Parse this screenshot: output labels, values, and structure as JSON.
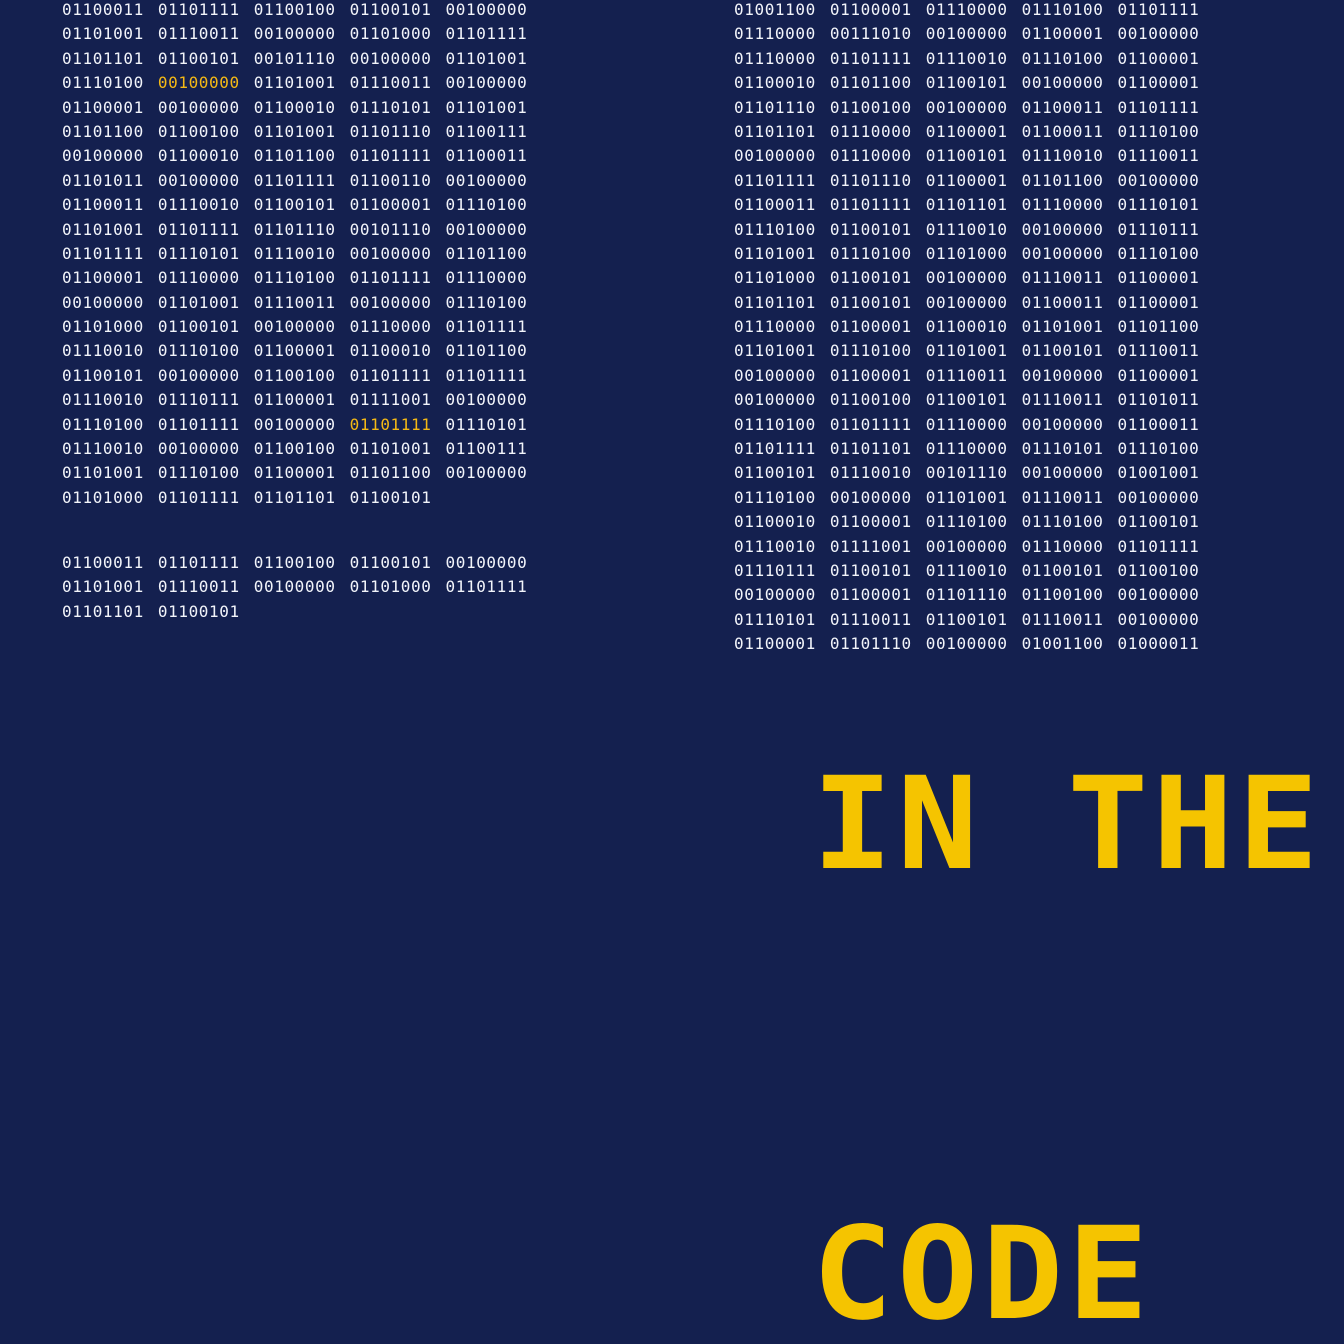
{
  "left_block_1": [
    [
      "01100011",
      "01101111",
      "01100100",
      "01100101",
      "00100000"
    ],
    [
      "01101001",
      "01110011",
      "00100000",
      "01101000",
      "01101111"
    ],
    [
      "01101101",
      "01100101",
      "00101110",
      "00100000",
      "01101001"
    ],
    [
      "01110100",
      "00100000",
      "01101001",
      "01110011",
      "00100000"
    ],
    [
      "01100001",
      "00100000",
      "01100010",
      "01110101",
      "01101001"
    ],
    [
      "01101100",
      "01100100",
      "01101001",
      "01101110",
      "01100111"
    ],
    [
      "00100000",
      "01100010",
      "01101100",
      "01101111",
      "01100011"
    ],
    [
      "01101011",
      "00100000",
      "01101111",
      "01100110",
      "00100000"
    ],
    [
      "01100011",
      "01110010",
      "01100101",
      "01100001",
      "01110100"
    ],
    [
      "01101001",
      "01101111",
      "01101110",
      "00101110",
      "00100000"
    ],
    [
      "01101111",
      "01110101",
      "01110010",
      "00100000",
      "01101100"
    ],
    [
      "01100001",
      "01110000",
      "01110100",
      "01101111",
      "01110000"
    ],
    [
      "00100000",
      "01101001",
      "01110011",
      "00100000",
      "01110100"
    ],
    [
      "01101000",
      "01100101",
      "00100000",
      "01110000",
      "01101111"
    ],
    [
      "01110010",
      "01110100",
      "01100001",
      "01100010",
      "01101100"
    ],
    [
      "01100101",
      "00100000",
      "01100100",
      "01101111",
      "01101111"
    ],
    [
      "01110010",
      "01110111",
      "01100001",
      "01111001",
      "00100000"
    ],
    [
      "01110100",
      "01101111",
      "00100000",
      "01101111",
      "01110101"
    ],
    [
      "01110010",
      "00100000",
      "01100100",
      "01101001",
      "01100111"
    ],
    [
      "01101001",
      "01110100",
      "01100001",
      "01101100",
      "00100000"
    ],
    [
      "01101000",
      "01101111",
      "01101101",
      "01100101"
    ]
  ],
  "left_highlights": [
    "3.1",
    "17.3"
  ],
  "left_block_2": [
    [
      "01100011",
      "01101111",
      "01100100",
      "01100101",
      "00100000"
    ],
    [
      "01101001",
      "01110011",
      "00100000",
      "01101000",
      "01101111"
    ],
    [
      "01101101",
      "01100101"
    ]
  ],
  "right_block": [
    [
      "01001100",
      "01100001",
      "01110000",
      "01110100",
      "01101111"
    ],
    [
      "01110000",
      "00111010",
      "00100000",
      "01100001",
      "00100000"
    ],
    [
      "01110000",
      "01101111",
      "01110010",
      "01110100",
      "01100001"
    ],
    [
      "01100010",
      "01101100",
      "01100101",
      "00100000",
      "01100001"
    ],
    [
      "01101110",
      "01100100",
      "00100000",
      "01100011",
      "01101111"
    ],
    [
      "01101101",
      "01110000",
      "01100001",
      "01100011",
      "01110100"
    ],
    [
      "00100000",
      "01110000",
      "01100101",
      "01110010",
      "01110011"
    ],
    [
      "01101111",
      "01101110",
      "01100001",
      "01101100",
      "00100000"
    ],
    [
      "01100011",
      "01101111",
      "01101101",
      "01110000",
      "01110101"
    ],
    [
      "01110100",
      "01100101",
      "01110010",
      "00100000",
      "01110111"
    ],
    [
      "01101001",
      "01110100",
      "01101000",
      "00100000",
      "01110100"
    ],
    [
      "01101000",
      "01100101",
      "00100000",
      "01110011",
      "01100001"
    ],
    [
      "01101101",
      "01100101",
      "00100000",
      "01100011",
      "01100001"
    ],
    [
      "01110000",
      "01100001",
      "01100010",
      "01101001",
      "01101100"
    ],
    [
      "01101001",
      "01110100",
      "01101001",
      "01100101",
      "01110011"
    ],
    [
      "00100000",
      "01100001",
      "01110011",
      "00100000",
      "01100001"
    ],
    [
      "00100000",
      "01100100",
      "01100101",
      "01110011",
      "01101011"
    ],
    [
      "01110100",
      "01101111",
      "01110000",
      "00100000",
      "01100011"
    ],
    [
      "01101111",
      "01101101",
      "01110000",
      "01110101",
      "01110100"
    ],
    [
      "01100101",
      "01110010",
      "00101110",
      "00100000",
      "01001001"
    ],
    [
      "01110100",
      "00100000",
      "01101001",
      "01110011",
      "00100000"
    ],
    [
      "01100010",
      "01100001",
      "01110100",
      "01110100",
      "01100101"
    ],
    [
      "01110010",
      "01111001",
      "00100000",
      "01110000",
      "01101111"
    ],
    [
      "01110111",
      "01100101",
      "01110010",
      "01100101",
      "01100100"
    ],
    [
      "00100000",
      "01100001",
      "01101110",
      "01100100",
      "00100000"
    ],
    [
      "01110101",
      "01110011",
      "01100101",
      "01110011",
      "00100000"
    ],
    [
      "01100001",
      "01101110",
      "00100000",
      "01001100",
      "01000011"
    ]
  ],
  "headline": {
    "line1": "IN THE",
    "line2": "CODE"
  },
  "colors": {
    "background": "#14204f",
    "text": "#f2f4fa",
    "accent": "#f5b915"
  }
}
